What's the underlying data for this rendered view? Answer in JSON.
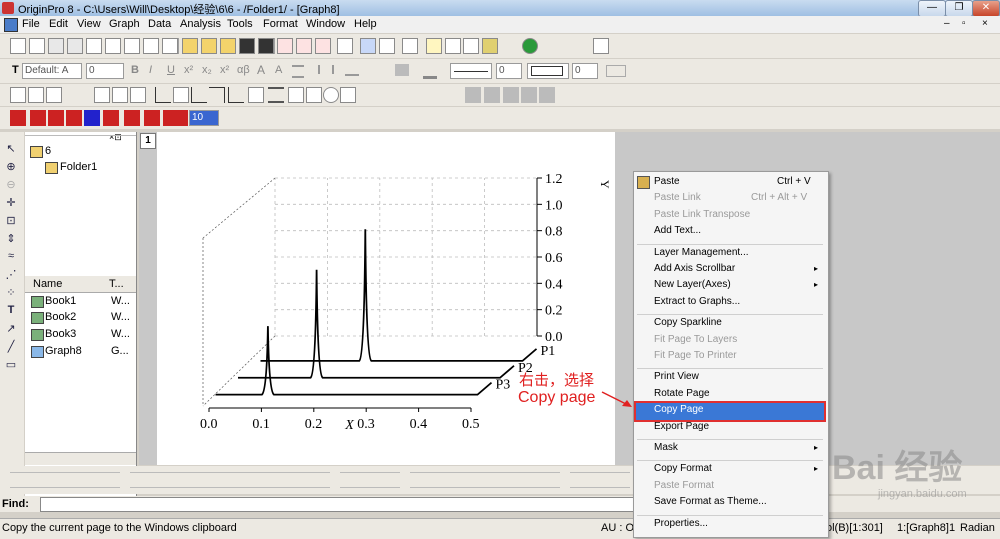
{
  "window": {
    "title": "OriginPro 8 - C:\\Users\\Will\\Desktop\\经验\\6\\6 - /Folder1/ - [Graph8]",
    "controls": [
      "—",
      "❐",
      "✕"
    ]
  },
  "menubar": {
    "items": [
      "File",
      "Edit",
      "View",
      "Graph",
      "Data",
      "Analysis",
      "Tools",
      "Format",
      "Window",
      "Help"
    ],
    "mdi_controls": [
      "–",
      "▫",
      "×"
    ]
  },
  "format_toolbar": {
    "font_combo": "Default: A",
    "size_combo": "0",
    "style_buttons": [
      "B",
      "I",
      "U",
      "x²",
      "x₂",
      "x²",
      "αβ",
      "A",
      "A"
    ],
    "line_width": "0",
    "border_width": "0"
  },
  "object_toolbar": {
    "zoom_value": "10"
  },
  "explorer": {
    "tree": [
      {
        "label": "6"
      },
      {
        "label": "Folder1"
      }
    ],
    "columns": [
      "Name",
      "T..."
    ],
    "items": [
      {
        "name": "Book1",
        "type": "W..."
      },
      {
        "name": "Book2",
        "type": "W..."
      },
      {
        "name": "Book3",
        "type": "W..."
      },
      {
        "name": "Graph8",
        "type": "G..."
      }
    ]
  },
  "graph": {
    "layer_badge": "1",
    "colors": {
      "axis": "#000000",
      "grid": "#bdbdbd",
      "peak": "#000000"
    }
  },
  "chart_data": {
    "type": "line",
    "subtype": "3D waterfall",
    "x": [
      0.0,
      0.1,
      0.2,
      0.3,
      0.4,
      0.5
    ],
    "xlabel": "X",
    "ylabel": "Y",
    "xticks": [
      "0.0",
      "0.1",
      "0.2",
      "0.3",
      "0.4",
      "0.5"
    ],
    "yticks": [
      "0.0",
      "0.2",
      "0.4",
      "0.6",
      "0.8",
      "1.0",
      "1.2"
    ],
    "xlim": [
      0.0,
      0.5
    ],
    "ylim": [
      0.0,
      1.2
    ],
    "grid": true,
    "series": [
      {
        "name": "P1",
        "peak_x": 0.2,
        "peak_y": 1.0
      },
      {
        "name": "P2",
        "peak_x": 0.15,
        "peak_y": 0.82
      },
      {
        "name": "P3",
        "peak_x": 0.1,
        "peak_y": 0.52
      }
    ]
  },
  "context_menu": {
    "items": [
      {
        "label": "Paste",
        "shortcut": "Ctrl + V",
        "disabled": false,
        "icon": "paste-icon"
      },
      {
        "label": "Paste Link",
        "shortcut": "Ctrl + Alt + V",
        "disabled": true
      },
      {
        "label": "Paste Link Transpose",
        "disabled": true
      },
      {
        "label": "Add Text...",
        "disabled": false
      },
      {
        "sep": true
      },
      {
        "label": "Layer Management...",
        "disabled": false
      },
      {
        "label": "Add Axis Scrollbar",
        "disabled": false,
        "submenu": true
      },
      {
        "label": "New Layer(Axes)",
        "disabled": false,
        "submenu": true
      },
      {
        "label": "Extract to Graphs...",
        "disabled": false
      },
      {
        "sep": true
      },
      {
        "label": "Copy Sparkline",
        "disabled": false
      },
      {
        "label": "Fit Page To Layers",
        "disabled": true
      },
      {
        "label": "Fit Page To Printer",
        "disabled": true
      },
      {
        "sep": true
      },
      {
        "label": "Print View",
        "disabled": false
      },
      {
        "label": "Rotate Page",
        "disabled": false
      },
      {
        "label": "Copy Page",
        "disabled": false,
        "highlighted": true
      },
      {
        "label": "Export Page",
        "disabled": false
      },
      {
        "sep": true
      },
      {
        "label": "Mask",
        "disabled": false,
        "submenu": true
      },
      {
        "sep": true
      },
      {
        "label": "Copy Format",
        "disabled": false,
        "submenu": true
      },
      {
        "label": "Paste Format",
        "disabled": true
      },
      {
        "label": "Save Format as Theme...",
        "disabled": false
      },
      {
        "sep": true
      },
      {
        "label": "Properties...",
        "disabled": false
      }
    ]
  },
  "annotation": {
    "line1": "右击，选择",
    "line2": "Copy page",
    "color": "#e02020"
  },
  "find": {
    "label": "Find:",
    "value": ""
  },
  "statusbar": {
    "message": "Copy the current page to the Windows clipboard",
    "au": "AU : O",
    "col": "ol(B)[1:301]",
    "layer": "1:[Graph8]1",
    "unit": "Radian"
  },
  "watermark": {
    "text": "Bai 经验",
    "url": "jingyan.baidu.com"
  }
}
